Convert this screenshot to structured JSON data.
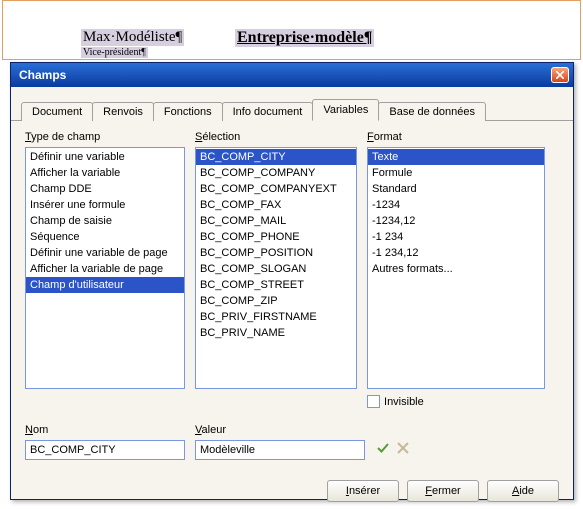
{
  "background": {
    "name": "Max·Modéliste¶",
    "subtitle": "Vice-président¶",
    "company": "Entreprise·modèle¶"
  },
  "dialog": {
    "title": "Champs",
    "tabs": {
      "document": "Document",
      "renvois": "Renvois",
      "fonctions": "Fonctions",
      "info": "Info document",
      "variables": "Variables",
      "db": "Base de données"
    },
    "labels": {
      "type_prefix": "T",
      "type_rest": "ype de champ",
      "selection_prefix": "S",
      "selection_rest": "élection",
      "format_prefix": "F",
      "format_rest": "ormat",
      "nom_prefix": "N",
      "nom_rest": "om",
      "valeur_prefix": "V",
      "valeur_rest": "aleur",
      "invisible_prefix": "I",
      "invisible_rest": "nvisible"
    },
    "type_list": [
      "Définir une variable",
      "Afficher la variable",
      "Champ DDE",
      "Insérer une formule",
      "Champ de saisie",
      "Séquence",
      "Définir une variable de page",
      "Afficher la variable de page",
      "Champ d'utilisateur"
    ],
    "type_selected": 8,
    "selection_list": [
      "BC_COMP_CITY",
      "BC_COMP_COMPANY",
      "BC_COMP_COMPANYEXT",
      "BC_COMP_FAX",
      "BC_COMP_MAIL",
      "BC_COMP_PHONE",
      "BC_COMP_POSITION",
      "BC_COMP_SLOGAN",
      "BC_COMP_STREET",
      "BC_COMP_ZIP",
      "BC_PRIV_FIRSTNAME",
      "BC_PRIV_NAME"
    ],
    "selection_selected": 0,
    "format_list": [
      "Texte",
      "Formule",
      "Standard",
      "-1234",
      "-1234,12",
      "-1 234",
      "-1 234,12",
      "Autres formats..."
    ],
    "format_selected": 0,
    "nom_value": "BC_COMP_CITY",
    "valeur_value": "Modèleville",
    "buttons": {
      "insert_prefix": "I",
      "insert_rest": "nsérer",
      "close_prefix": "F",
      "close_rest": "ermer",
      "help_prefix": "A",
      "help_rest": "ide"
    }
  }
}
